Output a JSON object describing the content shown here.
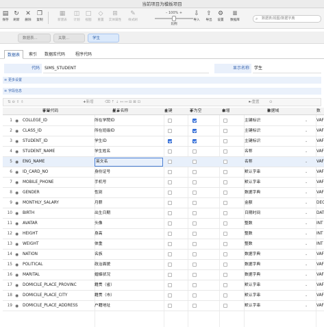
{
  "window": {
    "title": "当前项目为模板项目"
  },
  "toolbar": {
    "buttons": [
      {
        "label": "保存",
        "icon": "save-icon"
      },
      {
        "label": "刷新",
        "icon": "refresh-icon"
      },
      {
        "label": "删除",
        "icon": "delete-icon"
      },
      {
        "label": "复制",
        "icon": "copy-icon"
      },
      {
        "label": "新建表",
        "icon": "new-table-icon"
      },
      {
        "label": "计划",
        "icon": "plan-icon"
      },
      {
        "label": "视图",
        "icon": "view-icon"
      },
      {
        "label": "重置",
        "icon": "reset-icon"
      },
      {
        "label": "实体属性",
        "icon": "entity-icon"
      },
      {
        "label": "样式刷",
        "icon": "brush-icon"
      },
      {
        "label": "导入",
        "icon": "import-icon"
      },
      {
        "label": "导出",
        "icon": "export-icon"
      },
      {
        "label": "设置",
        "icon": "settings-icon"
      },
      {
        "label": "数据库",
        "icon": "database-icon"
      }
    ],
    "zoom_value": "100%",
    "zoom_label": "比例",
    "search_placeholder": "数据表/视图/数据字典"
  },
  "doc_tabs": [
    {
      "label": "数据表..."
    },
    {
      "label": "关联..."
    },
    {
      "label": "学生"
    }
  ],
  "sub_tabs": [
    "数据表",
    "索引",
    "数据库代码",
    "程序代码"
  ],
  "info": {
    "code_label": "代码",
    "code_value": "SIMS_STUDENT",
    "name_label": "显示名称",
    "name_value": "学生"
  },
  "sections": {
    "more_settings": "更多设置",
    "fields": "字段信息"
  },
  "grid_toolbar": {
    "add_label": "新增",
    "reset_label": "重置"
  },
  "columns": {
    "code": "字段代码",
    "name": "显示名称",
    "pk": "主键",
    "notnull": "不为空",
    "autoinc": "自增",
    "domain": "数据域",
    "dtype": "数"
  },
  "rows": [
    {
      "n": "1",
      "code": "COLLEGE_ID",
      "name": "所在学院ID",
      "pk": false,
      "nn": true,
      "ai": false,
      "domain": "主键标识",
      "dtype": "VAF"
    },
    {
      "n": "2",
      "code": "CLASS_ID",
      "name": "所在班级ID",
      "pk": false,
      "nn": true,
      "ai": false,
      "domain": "主键标识",
      "dtype": "VAF"
    },
    {
      "n": "3",
      "code": "STUDENT_ID",
      "name": "学生ID",
      "pk": true,
      "nn": true,
      "ai": false,
      "domain": "主键标识",
      "dtype": "VAF"
    },
    {
      "n": "4",
      "code": "STUDENT_NAME",
      "name": "学生姓名",
      "pk": false,
      "nn": false,
      "ai": false,
      "domain": "名称",
      "dtype": "VAF"
    },
    {
      "n": "5",
      "code": "ENG_NAME",
      "name": "英文名",
      "pk": false,
      "nn": false,
      "ai": false,
      "domain": "名称",
      "dtype": "VAF"
    },
    {
      "n": "6",
      "code": "ID_CARD_NO",
      "name": "身份证号",
      "pk": false,
      "nn": false,
      "ai": false,
      "domain": "默认字串",
      "dtype": "VAF"
    },
    {
      "n": "7",
      "code": "MOBILE_PHONE",
      "name": "手机号",
      "pk": false,
      "nn": false,
      "ai": false,
      "domain": "默认字串",
      "dtype": "VAF"
    },
    {
      "n": "8",
      "code": "GENDER",
      "name": "性别",
      "pk": false,
      "nn": false,
      "ai": false,
      "domain": "数据字典",
      "dtype": "VAF"
    },
    {
      "n": "9",
      "code": "MONTHLY_SALARY",
      "name": "月薪",
      "pk": false,
      "nn": false,
      "ai": false,
      "domain": "金额",
      "dtype": "DEC"
    },
    {
      "n": "10",
      "code": "BIRTH",
      "name": "出生日期",
      "pk": false,
      "nn": false,
      "ai": false,
      "domain": "日期时间",
      "dtype": "DAT"
    },
    {
      "n": "11",
      "code": "AVATAR",
      "name": "头像",
      "pk": false,
      "nn": false,
      "ai": false,
      "domain": "整数",
      "dtype": "INT"
    },
    {
      "n": "12",
      "code": "HEIGHT",
      "name": "身高",
      "pk": false,
      "nn": false,
      "ai": false,
      "domain": "整数",
      "dtype": "INT"
    },
    {
      "n": "13",
      "code": "WEIGHT",
      "name": "体重",
      "pk": false,
      "nn": false,
      "ai": false,
      "domain": "整数",
      "dtype": "INT"
    },
    {
      "n": "14",
      "code": "NATION",
      "name": "名族",
      "pk": false,
      "nn": false,
      "ai": false,
      "domain": "数据字典",
      "dtype": "VAF"
    },
    {
      "n": "15",
      "code": "POLITICAL",
      "name": "政治面貌",
      "pk": false,
      "nn": false,
      "ai": false,
      "domain": "数据字典",
      "dtype": "VAF"
    },
    {
      "n": "16",
      "code": "MARITAL",
      "name": "婚姻状况",
      "pk": false,
      "nn": false,
      "ai": false,
      "domain": "数据字典",
      "dtype": "VAF"
    },
    {
      "n": "17",
      "code": "DOMICILE_PLACE_PROVINC",
      "name": "籍贯（省）",
      "pk": false,
      "nn": false,
      "ai": false,
      "domain": "默认字串",
      "dtype": "VAF"
    },
    {
      "n": "18",
      "code": "DOMICILE_PLACE_CITY",
      "name": "籍贯（市）",
      "pk": false,
      "nn": false,
      "ai": false,
      "domain": "默认字串",
      "dtype": "VAF"
    },
    {
      "n": "19",
      "code": "DOMICILE_PLACE_ADDRESS",
      "name": "户籍地址",
      "pk": false,
      "nn": false,
      "ai": false,
      "domain": "默认字串",
      "dtype": "VAF"
    }
  ],
  "colors": {
    "accent": "#3b78e7",
    "label_blue": "#3a66b0"
  }
}
